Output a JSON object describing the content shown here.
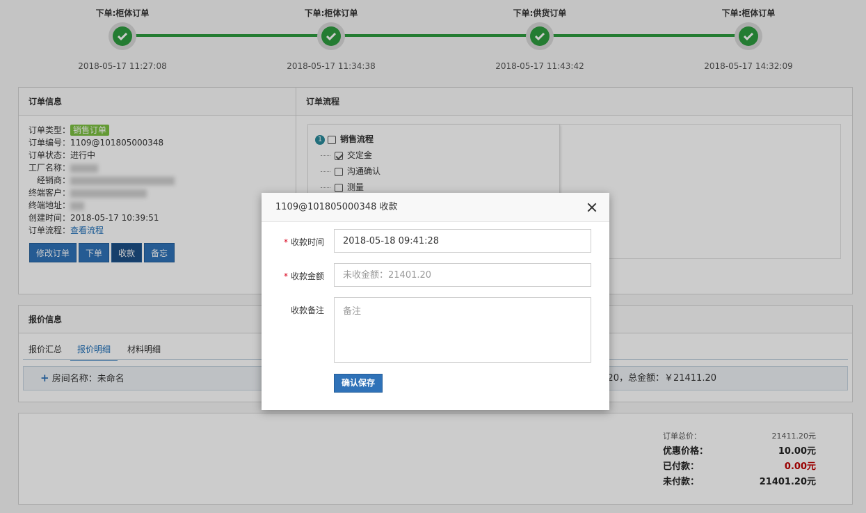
{
  "timeline": [
    {
      "title": "下单:柜体订单",
      "time": "2018-05-17 11:27:08"
    },
    {
      "title": "下单:柜体订单",
      "time": "2018-05-17 11:34:38"
    },
    {
      "title": "下单:供货订单",
      "time": "2018-05-17 11:43:42"
    },
    {
      "title": "下单:柜体订单",
      "time": "2018-05-17 14:32:09"
    }
  ],
  "order_info": {
    "title": "订单信息",
    "type_label": "订单类型：",
    "type_tag": "销售订单",
    "number_label": "订单编号：",
    "number": "1109@101805000348",
    "status_label": "订单状态：",
    "status": "进行中",
    "factory_label": "工厂名称：",
    "dealer_label": "经销商：",
    "customer_label": "终端客户：",
    "address_label": "终端地址：",
    "created_label": "创建时间：",
    "created": "2018-05-17 10:39:51",
    "flow_label": "订单流程：",
    "flow_link": "查看流程",
    "buttons": {
      "edit": "修改订单",
      "place": "下单",
      "collect": "收款",
      "memo": "备忘"
    }
  },
  "order_flow": {
    "title": "订单流程",
    "tree_number": "1",
    "root": "销售流程",
    "children": [
      {
        "label": "交定金",
        "checked": true
      },
      {
        "label": "沟通确认",
        "checked": false
      },
      {
        "label": "测量",
        "checked": false
      }
    ]
  },
  "quote_info": {
    "title": "报价信息",
    "tabs": [
      "报价汇总",
      "报价明细",
      "材料明细"
    ],
    "active_tab": "报价明细",
    "room_plus": "+",
    "room_name": "房间名称：未命名",
    "room_total": "20，总金额：￥21411.20"
  },
  "totals": {
    "total_label": "订单总价：",
    "total_value": "21411.20元",
    "discount_label": "优惠价格：",
    "discount_value": "10.00元",
    "paid_label": "已付款：",
    "paid_value": "0.00元",
    "unpaid_label": "未付款：",
    "unpaid_value": "21401.20元"
  },
  "modal": {
    "title": "1109@101805000348 收款",
    "time_label": "收款时间",
    "time_value": "2018-05-18 09:41:28",
    "amount_label": "收款金额",
    "amount_placeholder": "未收金额：21401.20",
    "note_label": "收款备注",
    "note_placeholder": "备注",
    "save_label": "确认保存",
    "required_mark": "*"
  },
  "colors": {
    "accent": "#2f72b8",
    "success": "#2e9c3f",
    "tag_green": "#7cc142",
    "danger": "#c00000"
  }
}
